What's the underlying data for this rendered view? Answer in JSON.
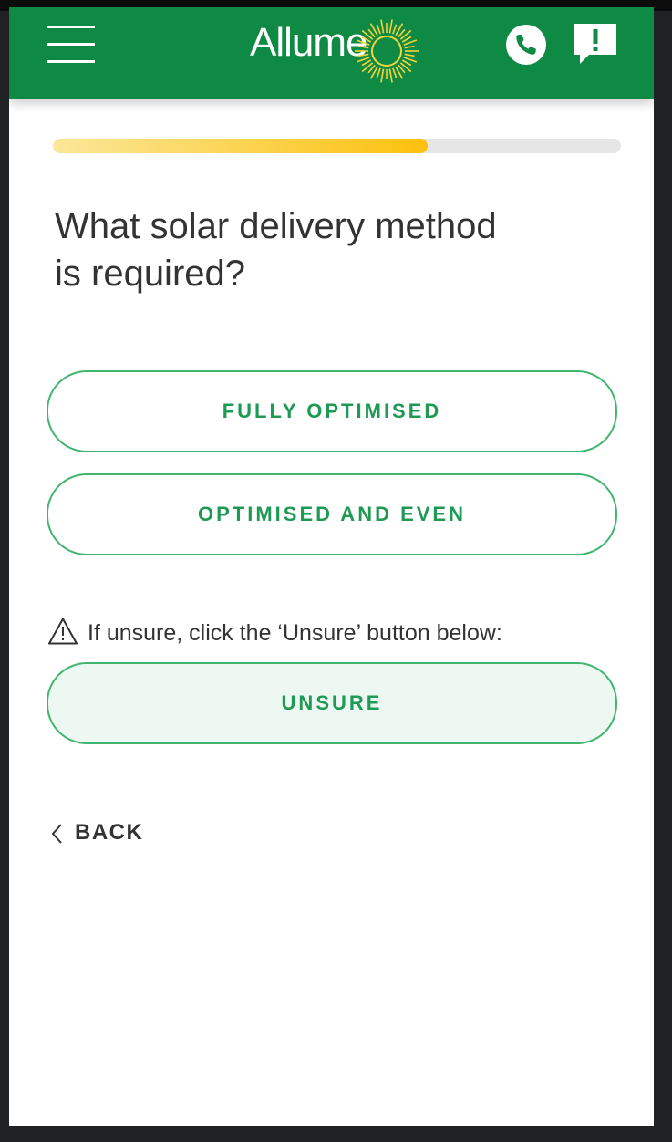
{
  "header": {
    "brand": "Allume",
    "background_color": "#0f8a45",
    "icons": {
      "menu": "hamburger-menu-icon",
      "phone": "phone-icon",
      "feedback": "feedback-exclamation-icon",
      "logo_mark": "sun-icon"
    }
  },
  "progress": {
    "fraction": 0.66,
    "fill_color_start": "#fbe79a",
    "fill_color_end": "#fcc10d",
    "track_color": "#e6e6e6"
  },
  "question": {
    "line1": "What solar delivery method",
    "line2": "is required?"
  },
  "options": [
    {
      "label": "FULLY OPTIMISED"
    },
    {
      "label": "OPTIMISED AND EVEN"
    }
  ],
  "hint": {
    "text": "If unsure, click the ‘Unsure’ button below:",
    "icon": "warning-icon"
  },
  "unsure": {
    "label": "UNSURE"
  },
  "back": {
    "label": "BACK",
    "icon": "chevron-left-icon"
  },
  "colors": {
    "accent_green": "#1f9a54",
    "button_border": "#3fb56e",
    "text_dark": "#333333"
  }
}
